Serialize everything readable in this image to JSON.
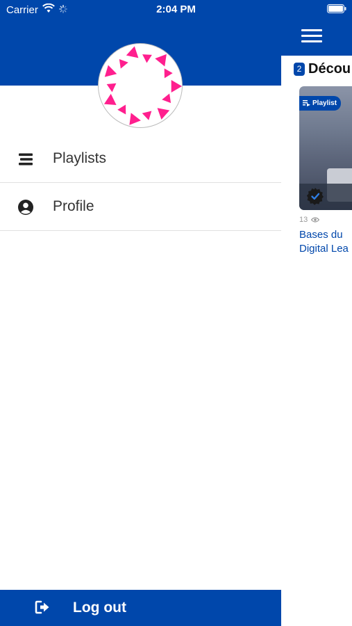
{
  "status_bar": {
    "carrier": "Carrier",
    "time": "2:04 PM",
    "icons": [
      "wifi-icon",
      "activity-icon",
      "battery-icon"
    ]
  },
  "drawer": {
    "avatar_icon": "logo-avatar",
    "menu_items": [
      {
        "label": "Playlists",
        "icon": "playlists-icon"
      },
      {
        "label": "Profile",
        "icon": "profile-icon"
      }
    ],
    "logout": {
      "label": "Log out",
      "icon": "logout-icon"
    }
  },
  "main": {
    "menu_icon": "hamburger-menu-icon",
    "section": {
      "badge": "2",
      "title": "Décou"
    },
    "card": {
      "badge_label": "Playlist",
      "views": "13",
      "title_line1": "Bases du",
      "title_line2": "Digital Lea"
    }
  },
  "colors": {
    "brand_blue": "#0047ab",
    "logo_pink": "#ff1f8e",
    "text_dark": "#333333"
  }
}
